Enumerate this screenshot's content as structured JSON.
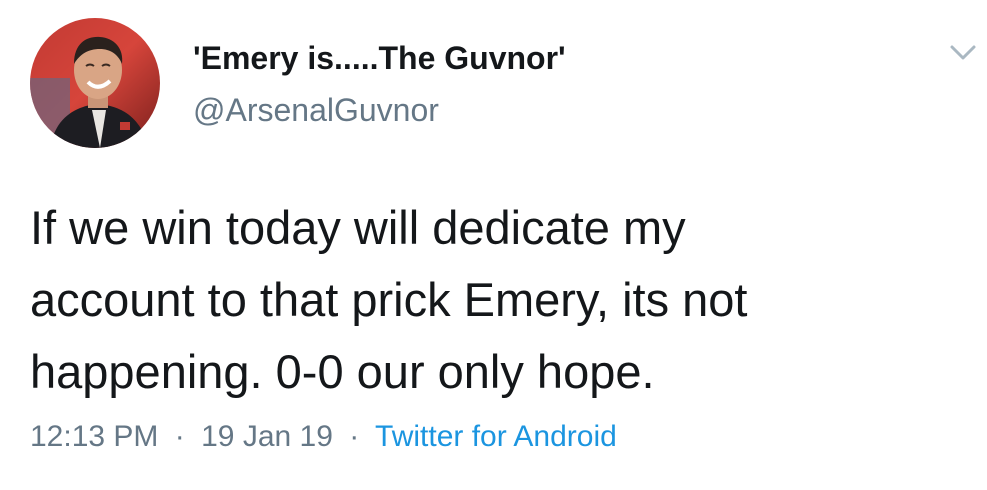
{
  "tweet": {
    "author": {
      "display_name": "'Emery is.....The Guvnor'",
      "handle": "@ArsenalGuvnor"
    },
    "text": "If we win today will dedicate my\naccount to that prick Emery, its not\nhappening. 0-0 our only hope.",
    "time": "12:13 PM",
    "date": "19 Jan 19",
    "separator": "·",
    "source": "Twitter for Android"
  },
  "icons": {
    "menu": "chevron-down-icon",
    "avatar": "profile-photo"
  },
  "colors": {
    "text": "#14171a",
    "secondary": "#657786",
    "link": "#1b95e0",
    "chevron": "#aab8c2"
  }
}
